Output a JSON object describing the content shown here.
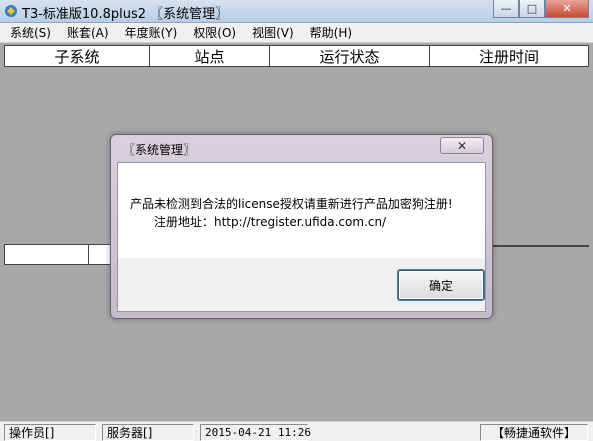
{
  "window": {
    "title": "T3-标准版10.8plus2 〖系统管理〗",
    "controls": {
      "minimize": "—",
      "maximize": "□",
      "close": "✕"
    }
  },
  "menu": {
    "items": [
      {
        "label": "系统(S)"
      },
      {
        "label": "账套(A)"
      },
      {
        "label": "年度账(Y)"
      },
      {
        "label": "权限(O)"
      },
      {
        "label": "视图(V)"
      },
      {
        "label": "帮助(H)"
      }
    ]
  },
  "table": {
    "columns": [
      {
        "label": "子系统"
      },
      {
        "label": "站点"
      },
      {
        "label": "运行状态"
      },
      {
        "label": "注册时间"
      }
    ]
  },
  "dialog": {
    "title": "〖系统管理〗",
    "close_label": "✕",
    "message_line1": "产品未检测到合法的license授权请重新进行产品加密狗注册!",
    "message_line2": "注册地址：http://tregister.ufida.com.cn/",
    "ok_label": "确定"
  },
  "status": {
    "operator": "操作员[]",
    "server": "服务器[]",
    "datetime": "2015-04-21 11:26",
    "brand": "【畅捷通软件】"
  },
  "colors": {
    "workspace": "#a8a8a8",
    "title_bar": "#c6d6ea",
    "close_button": "#c74b36",
    "dialog_frame": "#cec6d2"
  }
}
